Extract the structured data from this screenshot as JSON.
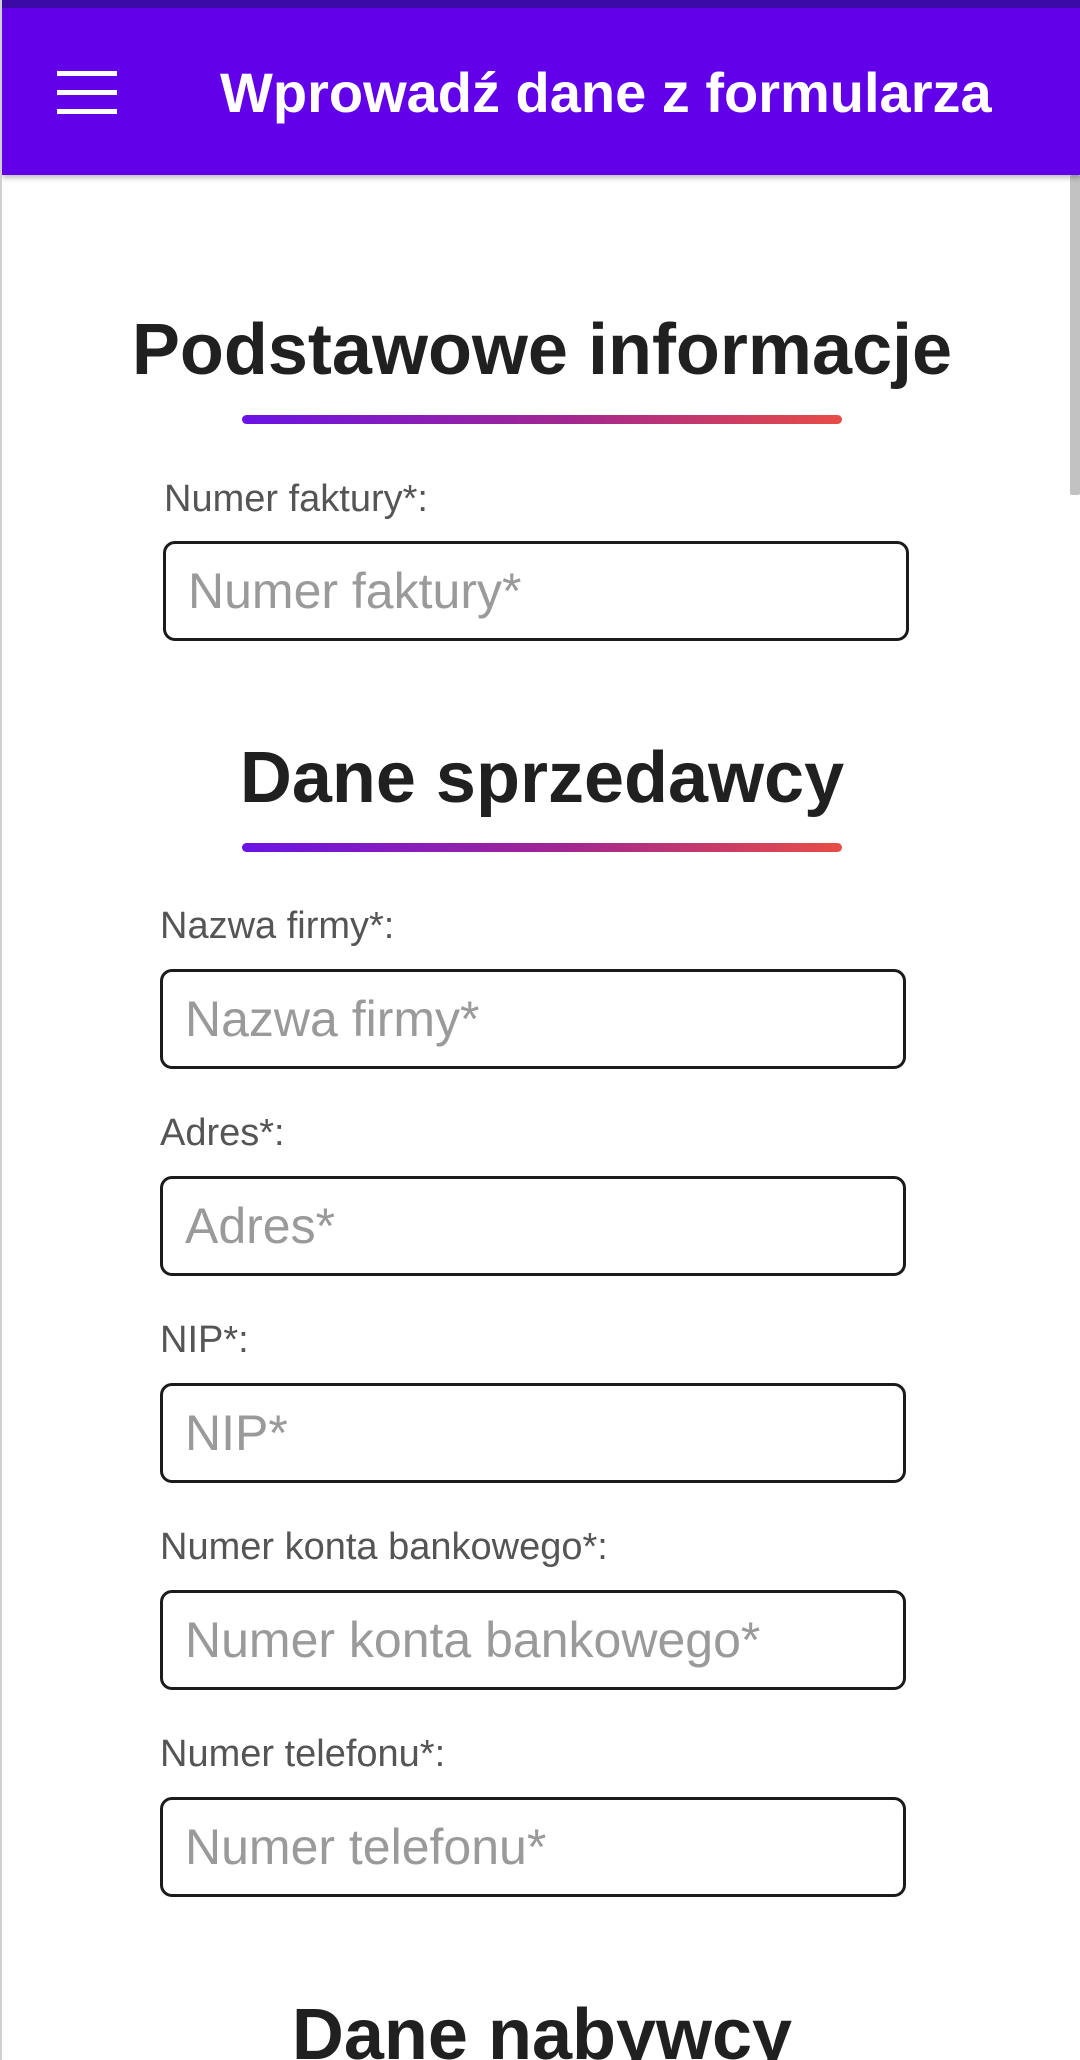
{
  "app_bar": {
    "title": "Wprowadź dane z formularza",
    "menu_icon": "hamburger-menu-icon",
    "background": "#6200ea"
  },
  "sections": {
    "basic": {
      "title": "Podstawowe informacje",
      "invoice_number": {
        "label": "Numer faktury*:",
        "placeholder": "Numer faktury*",
        "value": ""
      }
    },
    "seller": {
      "title": "Dane sprzedawcy",
      "company_name": {
        "label": "Nazwa firmy*:",
        "placeholder": "Nazwa firmy*",
        "value": ""
      },
      "address": {
        "label": "Adres*:",
        "placeholder": "Adres*",
        "value": ""
      },
      "nip": {
        "label": "NIP*:",
        "placeholder": "NIP*",
        "value": ""
      },
      "bank_account": {
        "label": "Numer konta bankowego*:",
        "placeholder": "Numer konta bankowego*",
        "value": ""
      },
      "phone": {
        "label": "Numer telefonu*:",
        "placeholder": "Numer telefonu*",
        "value": ""
      }
    },
    "buyer": {
      "title": "Dane nabywcy"
    }
  },
  "colors": {
    "accent": "#6200ea",
    "underline_start": "#6a12e6",
    "underline_end": "#e84c46"
  }
}
